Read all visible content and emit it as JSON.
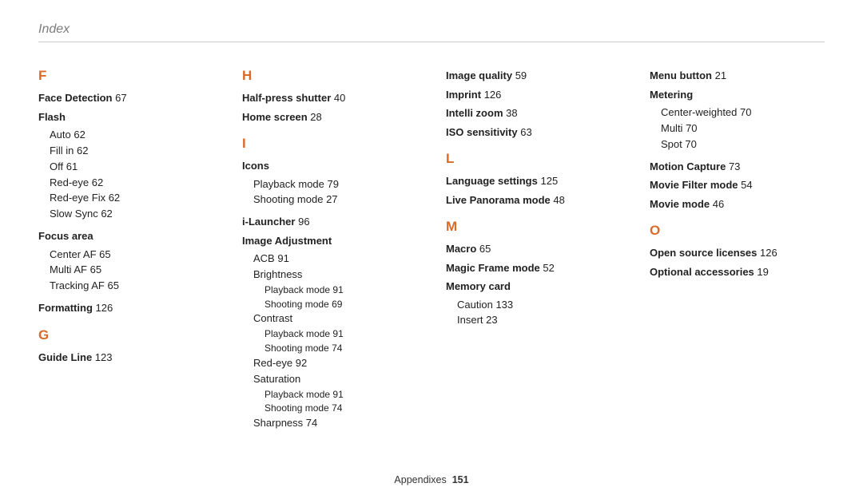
{
  "page_title": "Index",
  "footer": {
    "label": "Appendixes",
    "page": "151"
  },
  "col1": {
    "letterF": "F",
    "faceDetection": {
      "t": "Face Detection",
      "p": "67"
    },
    "flash": {
      "t": "Flash",
      "auto": {
        "t": "Auto",
        "p": "62"
      },
      "fillin": {
        "t": "Fill in",
        "p": "62"
      },
      "off": {
        "t": "Off",
        "p": "61"
      },
      "redeye": {
        "t": "Red-eye",
        "p": "62"
      },
      "redeyefix": {
        "t": "Red-eye Fix",
        "p": "62"
      },
      "slowsync": {
        "t": "Slow Sync",
        "p": "62"
      }
    },
    "focusArea": {
      "t": "Focus area",
      "center": {
        "t": "Center AF",
        "p": "65"
      },
      "multi": {
        "t": "Multi AF",
        "p": "65"
      },
      "tracking": {
        "t": "Tracking AF",
        "p": "65"
      }
    },
    "formatting": {
      "t": "Formatting",
      "p": "126"
    },
    "letterG": "G",
    "guideLine": {
      "t": "Guide Line",
      "p": "123"
    }
  },
  "col2": {
    "letterH": "H",
    "halfpress": {
      "t": "Half-press shutter",
      "p": "40"
    },
    "homescreen": {
      "t": "Home screen",
      "p": "28"
    },
    "letterI": "I",
    "icons": {
      "t": "Icons",
      "playback": {
        "t": "Playback mode",
        "p": "79"
      },
      "shooting": {
        "t": "Shooting mode",
        "p": "27"
      }
    },
    "ilauncher": {
      "t": "i-Launcher",
      "p": "96"
    },
    "imageAdj": {
      "t": "Image Adjustment",
      "acb": {
        "t": "ACB",
        "p": "91"
      },
      "brightness": {
        "t": "Brightness",
        "playback": {
          "t": "Playback mode",
          "p": "91"
        },
        "shooting": {
          "t": "Shooting mode",
          "p": "69"
        }
      },
      "contrast": {
        "t": "Contrast",
        "playback": {
          "t": "Playback mode",
          "p": "91"
        },
        "shooting": {
          "t": "Shooting mode",
          "p": "74"
        }
      },
      "redeye": {
        "t": "Red-eye",
        "p": "92"
      },
      "saturation": {
        "t": "Saturation",
        "playback": {
          "t": "Playback mode",
          "p": "91"
        },
        "shooting": {
          "t": "Shooting mode",
          "p": "74"
        }
      },
      "sharpness": {
        "t": "Sharpness",
        "p": "74"
      }
    }
  },
  "col3": {
    "imageQuality": {
      "t": "Image quality",
      "p": "59"
    },
    "imprint": {
      "t": "Imprint",
      "p": "126"
    },
    "intelliZoom": {
      "t": "Intelli zoom",
      "p": "38"
    },
    "iso": {
      "t": "ISO sensitivity",
      "p": "63"
    },
    "letterL": "L",
    "language": {
      "t": "Language settings",
      "p": "125"
    },
    "livePano": {
      "t": "Live Panorama mode",
      "p": "48"
    },
    "letterM": "M",
    "macro": {
      "t": "Macro",
      "p": "65"
    },
    "magicFrame": {
      "t": "Magic Frame mode",
      "p": "52"
    },
    "memoryCard": {
      "t": "Memory card",
      "caution": {
        "t": "Caution",
        "p": "133"
      },
      "insert": {
        "t": "Insert",
        "p": "23"
      }
    }
  },
  "col4": {
    "menuButton": {
      "t": "Menu button",
      "p": "21"
    },
    "metering": {
      "t": "Metering",
      "center": {
        "t": "Center-weighted",
        "p": "70"
      },
      "multi": {
        "t": "Multi",
        "p": "70"
      },
      "spot": {
        "t": "Spot",
        "p": "70"
      }
    },
    "motionCapture": {
      "t": "Motion Capture",
      "p": "73"
    },
    "movieFilter": {
      "t": "Movie Filter mode",
      "p": "54"
    },
    "movieMode": {
      "t": "Movie mode",
      "p": "46"
    },
    "letterO": "O",
    "openSource": {
      "t": "Open source licenses",
      "p": "126"
    },
    "optional": {
      "t": "Optional accessories",
      "p": "19"
    }
  }
}
